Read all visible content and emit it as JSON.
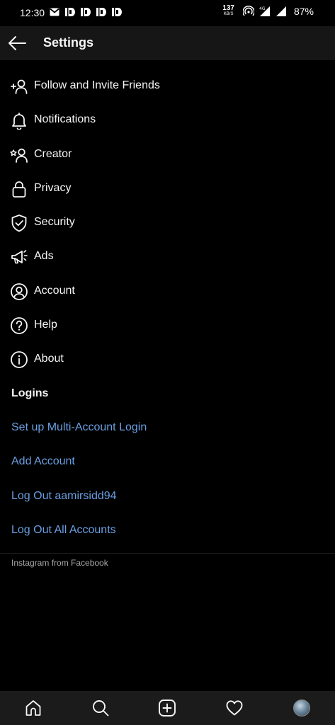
{
  "status_bar": {
    "time": "12:30",
    "net_speed": "137",
    "net_speed_unit": "KB/S",
    "battery": "87%"
  },
  "header": {
    "title": "Settings"
  },
  "settings": [
    {
      "label": "Follow and Invite Friends",
      "icon": "add-person-icon"
    },
    {
      "label": "Notifications",
      "icon": "bell-icon"
    },
    {
      "label": "Creator",
      "icon": "creator-icon"
    },
    {
      "label": "Privacy",
      "icon": "lock-icon"
    },
    {
      "label": "Security",
      "icon": "shield-icon"
    },
    {
      "label": "Ads",
      "icon": "megaphone-icon"
    },
    {
      "label": "Account",
      "icon": "account-icon"
    },
    {
      "label": "Help",
      "icon": "help-icon"
    },
    {
      "label": "About",
      "icon": "info-icon"
    }
  ],
  "logins": {
    "header": "Logins",
    "links": [
      "Set up Multi-Account Login",
      "Add Account",
      "Log Out aamirsidd94",
      "Log Out All Accounts"
    ]
  },
  "footer": {
    "text": "Instagram from Facebook"
  },
  "colors": {
    "background": "#000000",
    "header_bg": "#161616",
    "link": "#6a9fe3",
    "text": "#f5f5f5",
    "nav_bg": "#1b1b1b"
  },
  "bottom_nav": [
    "home-icon",
    "search-icon",
    "new-post-icon",
    "heart-icon",
    "profile-avatar"
  ]
}
